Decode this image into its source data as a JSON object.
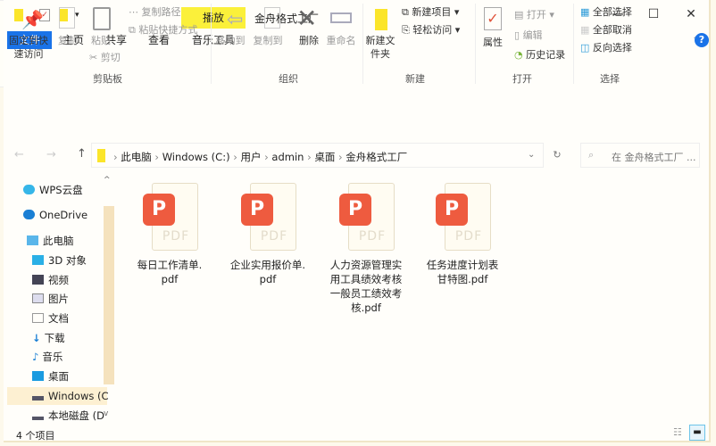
{
  "window": {
    "title": "金舟格式工厂",
    "context_tab": "播放",
    "context_subtab": "音乐工具",
    "controls": {
      "minimize": "—",
      "maximize": "☐",
      "close": "✕"
    },
    "help": "?"
  },
  "tabs": [
    {
      "label": "文件",
      "active": true
    },
    {
      "label": "主页"
    },
    {
      "label": "共享"
    },
    {
      "label": "查看"
    }
  ],
  "ribbon": {
    "clipboard": {
      "group": "剪贴板",
      "pin": "固定到快速访问",
      "copy": "复制",
      "paste": "粘贴",
      "copy_path": "复制路径",
      "paste_shortcut": "粘贴快捷方式",
      "cut": "剪切"
    },
    "organize": {
      "group": "组织",
      "move_to": "移动到",
      "copy_to": "复制到",
      "delete": "删除",
      "rename": "重命名"
    },
    "new": {
      "group": "新建",
      "new_folder": "新建文件夹",
      "new_item": "新建项目",
      "easy_access": "轻松访问"
    },
    "open": {
      "group": "打开",
      "properties": "属性",
      "open": "打开",
      "edit": "编辑",
      "history": "历史记录"
    },
    "select": {
      "group": "选择",
      "select_all": "全部选择",
      "select_none": "全部取消",
      "invert": "反向选择"
    }
  },
  "address": {
    "crumbs": [
      "此电脑",
      "Windows (C:)",
      "用户",
      "admin",
      "桌面",
      "金舟格式工厂"
    ],
    "search_placeholder": "在 金舟格式工厂 ..."
  },
  "nav": [
    {
      "label": "WPS云盘",
      "icon": "cloud-icon"
    },
    {
      "label": "OneDrive",
      "icon": "cloud-icon"
    },
    {
      "label": "此电脑",
      "icon": "computer-icon"
    },
    {
      "label": "3D 对象",
      "icon": "cube-icon"
    },
    {
      "label": "视频",
      "icon": "video-icon"
    },
    {
      "label": "图片",
      "icon": "picture-icon"
    },
    {
      "label": "文档",
      "icon": "document-icon"
    },
    {
      "label": "下载",
      "icon": "download-icon"
    },
    {
      "label": "音乐",
      "icon": "music-icon"
    },
    {
      "label": "桌面",
      "icon": "desktop-icon"
    },
    {
      "label": "Windows (C",
      "icon": "drive-icon",
      "selected": true
    },
    {
      "label": "本地磁盘 (D",
      "icon": "drive-icon"
    }
  ],
  "files": [
    {
      "name": "每日工作清单.pdf",
      "lines": [
        "每日工作清单.",
        "pdf"
      ]
    },
    {
      "name": "企业实用报价单.pdf",
      "lines": [
        "企业实用报价单.",
        "pdf"
      ]
    },
    {
      "name": "人力资源管理实用工具绩效考核一般员工绩效考核.pdf",
      "lines": [
        "人力资源管理实",
        "用工具绩效考核",
        "一般员工绩效考",
        "核.pdf"
      ]
    },
    {
      "name": "任务进度计划表甘特图.pdf",
      "lines": [
        "任务进度计划表",
        "甘特图.pdf"
      ]
    }
  ],
  "file_icon": {
    "badge": "P",
    "label": "PDF"
  },
  "status": {
    "count": "4 个项目"
  },
  "colors": {
    "accent": "#1a73e8",
    "context": "#fbf03a",
    "pdf": "#ee5b3f"
  }
}
